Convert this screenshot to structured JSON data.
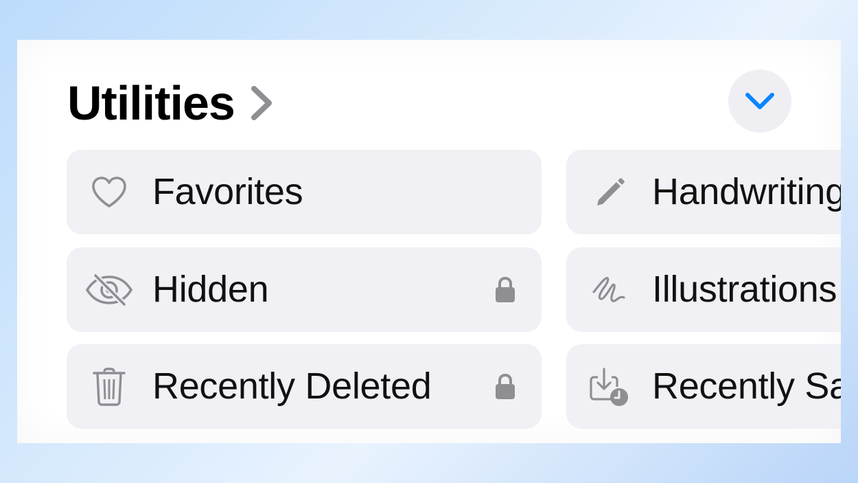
{
  "section": {
    "title": "Utilities",
    "title_chevron_icon": "chevron-right-icon",
    "collapse_icon": "chevron-down-icon"
  },
  "colors": {
    "accent": "#0a84ff",
    "tile_bg": "#f0f0f5",
    "icon_gray": "#8e8e93",
    "button_bg": "#efeff3"
  },
  "items": [
    {
      "label": "Favorites",
      "icon": "heart-icon",
      "locked": false
    },
    {
      "label": "Handwriting",
      "icon": "pencil-icon",
      "locked": false
    },
    {
      "label": "Hidden",
      "icon": "eye-slash-icon",
      "locked": true
    },
    {
      "label": "Illustrations",
      "icon": "scribble-icon",
      "locked": false
    },
    {
      "label": "Recently Deleted",
      "icon": "trash-icon",
      "locked": true
    },
    {
      "label": "Recently Saved",
      "icon": "tray-download-clock-icon",
      "locked": false
    }
  ]
}
